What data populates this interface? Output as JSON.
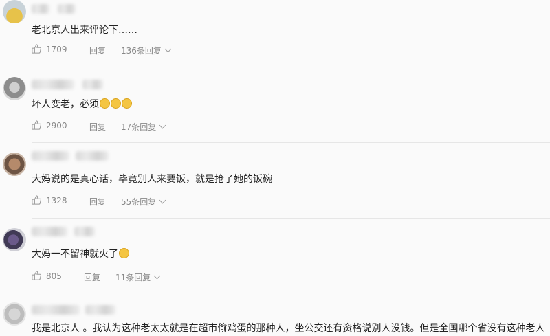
{
  "comments": [
    {
      "text": "老北京人出来评论下……",
      "likes": "1709",
      "reply": "回复",
      "replies": "136条回复",
      "emoji": 0
    },
    {
      "text": "坏人变老，必须",
      "likes": "2900",
      "reply": "回复",
      "replies": "17条回复",
      "emoji": 3
    },
    {
      "text": "大妈说的是真心话，毕竟别人来要饭，就是抢了她的饭碗",
      "likes": "1328",
      "reply": "回复",
      "replies": "55条回复",
      "emoji": 0
    },
    {
      "text": "大妈一不留神就火了",
      "likes": "805",
      "reply": "回复",
      "replies": "11条回复",
      "emoji": 1
    },
    {
      "text": "我是北京人 。我认为这种老太太就是在超市偷鸡蛋的那种人，坐公交还有资格说别人没钱。但是全国哪个省没有这种老人",
      "emoji": 0
    }
  ],
  "colors": {
    "background": "#fafafa",
    "text": "#222222",
    "meta": "#888888",
    "divider": "#e6e6e6"
  },
  "icons": {
    "like": "thumbs-up-icon",
    "expand": "chevron-down-icon"
  }
}
